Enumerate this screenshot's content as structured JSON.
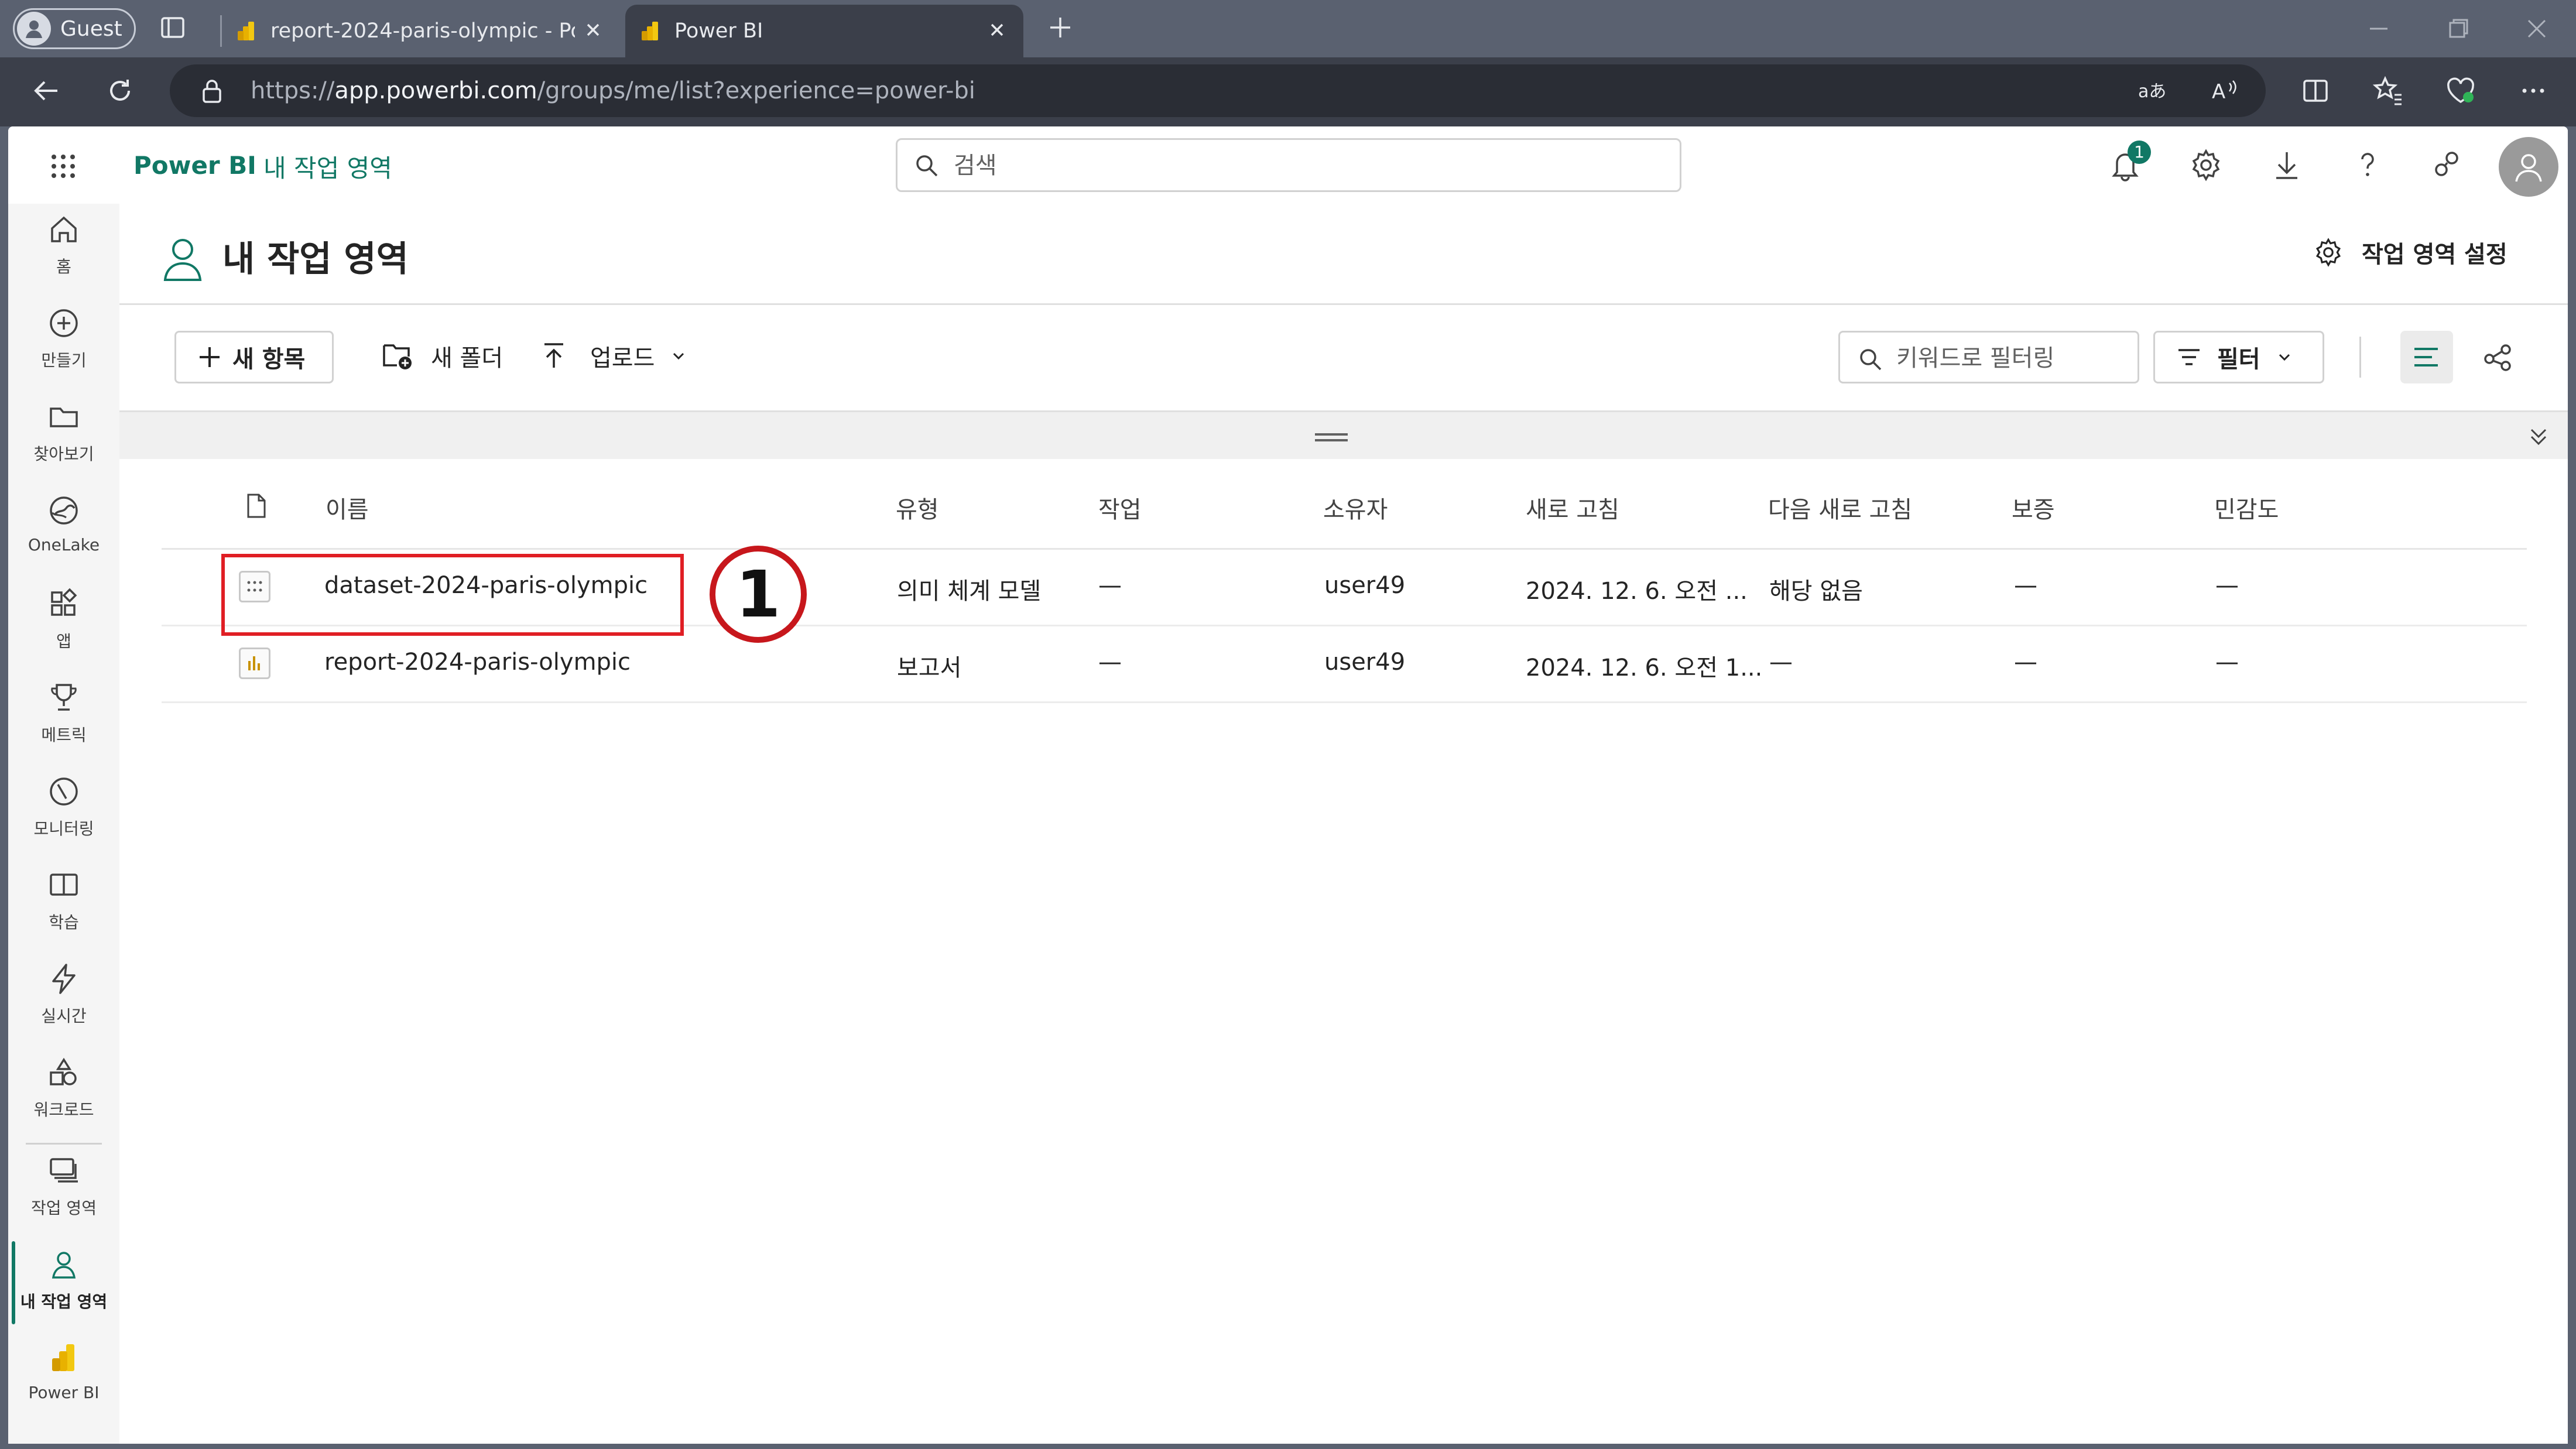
{
  "browser": {
    "profile_label": "Guest",
    "tabs": [
      {
        "title": "report-2024-paris-olympic - Power BI",
        "active": false
      },
      {
        "title": "Power BI",
        "active": true
      }
    ],
    "url_prefix": "https://",
    "url_host": "app.powerbi.com",
    "url_path": "/groups/me/list?experience=power-bi"
  },
  "appbar": {
    "brand": "Power BI",
    "breadcrumb": "내 작업 영역",
    "search_placeholder": "검색",
    "notification_count": "1"
  },
  "rail": [
    {
      "icon": "home-icon",
      "label": "홈"
    },
    {
      "icon": "create-icon",
      "label": "만들기"
    },
    {
      "icon": "folder-icon",
      "label": "찾아보기"
    },
    {
      "icon": "onelake-icon",
      "label": "OneLake"
    },
    {
      "icon": "apps-icon",
      "label": "앱"
    },
    {
      "icon": "trophy-icon",
      "label": "메트릭"
    },
    {
      "icon": "monitor-icon",
      "label": "모니터링"
    },
    {
      "icon": "book-icon",
      "label": "학습"
    },
    {
      "icon": "lightning-icon",
      "label": "실시간"
    },
    {
      "icon": "workload-icon",
      "label": "워크로드"
    },
    {
      "icon": "workspaces-icon",
      "label": "작업 영역"
    },
    {
      "icon": "person-icon",
      "label": "내 작업 영역"
    },
    {
      "icon": "powerbi-logo-icon",
      "label": "Power BI"
    }
  ],
  "workspace": {
    "title": "내 작업 영역",
    "settings_label": "작업 영역 설정"
  },
  "commands": {
    "new_item": "새 항목",
    "new_folder": "새 폴더",
    "upload": "업로드",
    "filter_placeholder": "키워드로 필터링",
    "filter": "필터"
  },
  "table": {
    "columns": [
      "이름",
      "유형",
      "작업",
      "소유자",
      "새로 고침",
      "다음 새로 고침",
      "보증",
      "민감도"
    ],
    "rows": [
      {
        "icon": "semantic-model-icon",
        "name": "dataset-2024-paris-olympic",
        "type": "의미 체계 모델",
        "task": "—",
        "owner": "user49",
        "refreshed": "2024. 12. 6. 오전 ...",
        "next_refresh": "해당 없음",
        "endorsement": "—",
        "sensitivity": "—"
      },
      {
        "icon": "report-icon",
        "name": "report-2024-paris-olympic",
        "type": "보고서",
        "task": "—",
        "owner": "user49",
        "refreshed": "2024. 12. 6. 오전 1...",
        "next_refresh": "—",
        "endorsement": "—",
        "sensitivity": "—"
      }
    ]
  },
  "annotation": {
    "step": "1",
    "color": "#e01e24"
  },
  "colors": {
    "accent": "#117865",
    "browser_chrome": "#3b3f4a"
  }
}
